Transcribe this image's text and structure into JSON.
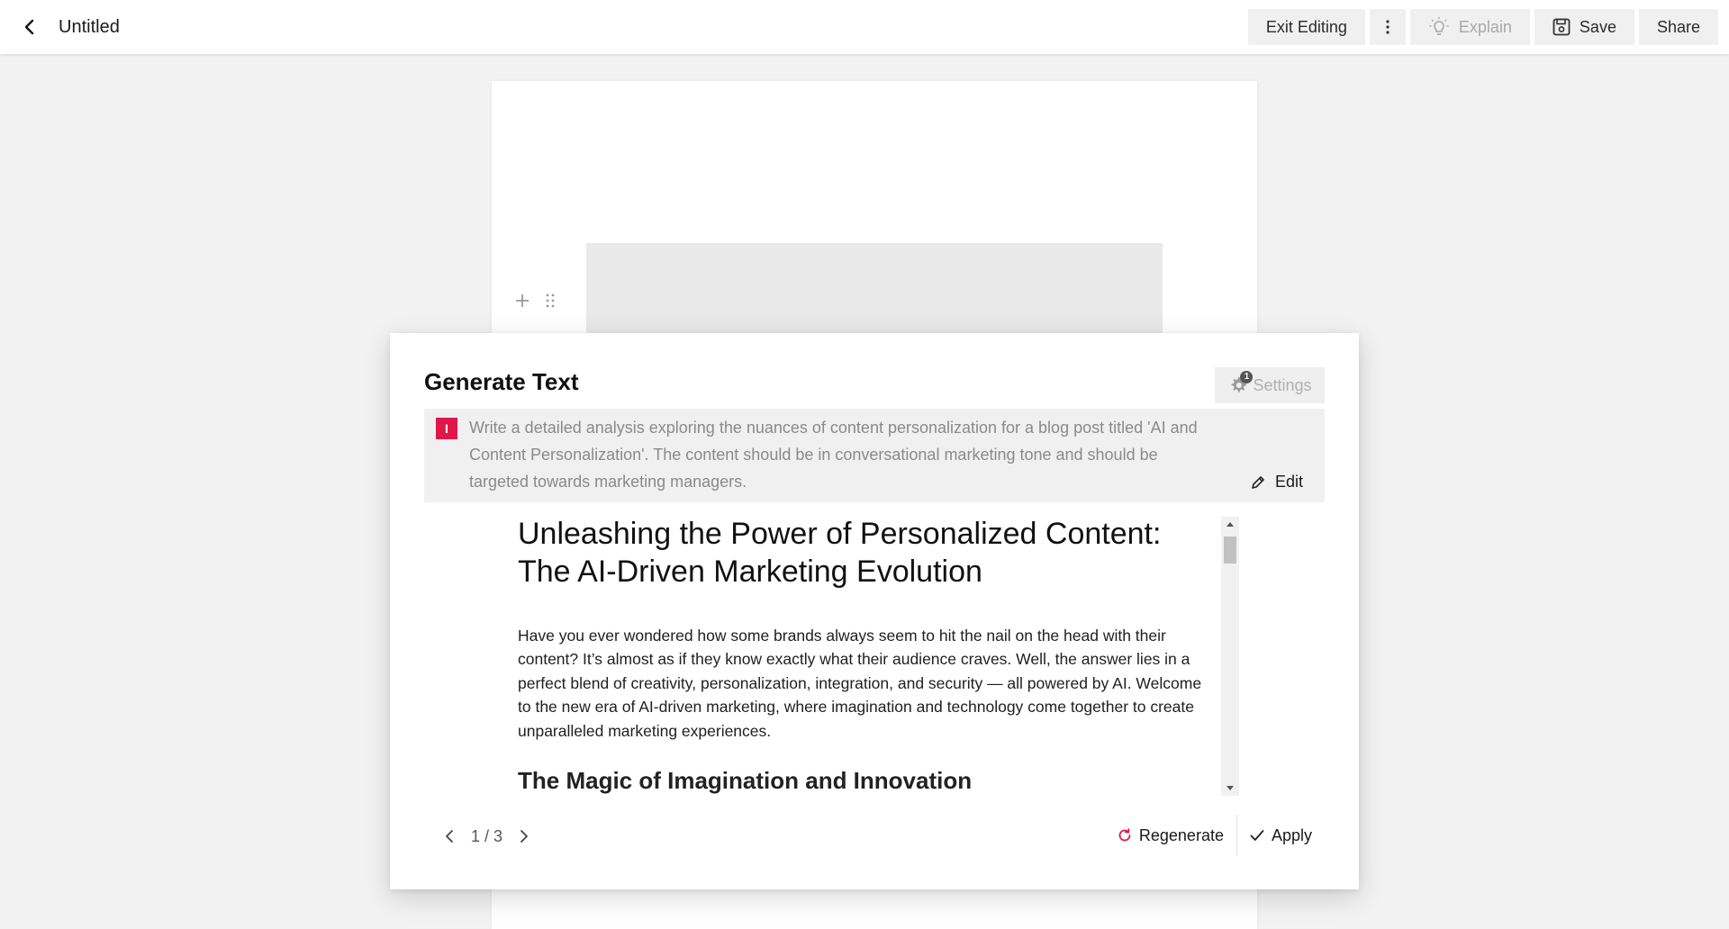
{
  "header": {
    "title": "Untitled",
    "exit_editing": "Exit Editing",
    "explain": "Explain",
    "save": "Save",
    "share": "Share"
  },
  "modal": {
    "title": "Generate Text",
    "settings": "Settings",
    "settings_badge": "1",
    "user_initial": "I",
    "prompt": "Write a detailed analysis exploring the nuances of content personalization for a blog post titled 'AI and Content Personalization'. The content should be in conversational marketing tone and should be targeted towards marketing managers.",
    "edit": "Edit",
    "result": {
      "heading": "Unleashing the Power of Personalized Content: The AI-Driven Marketing Evolution",
      "paragraph": "Have you ever wondered how some brands always seem to hit the nail on the head with their content? It’s almost as if they know exactly what their audience craves. Well, the answer lies in a perfect blend of creativity, personalization, integration, and security — all powered by AI. Welcome to the new era of AI-driven marketing, where imagination and technology come together to create unparalleled marketing experiences.",
      "subheading": "The Magic of Imagination and Innovation"
    },
    "pager": "1 / 3",
    "regenerate": "Regenerate",
    "apply": "Apply"
  },
  "colors": {
    "accent_red": "#e0174a",
    "background": "#f2f2f2",
    "muted_text": "#8a8a8a"
  },
  "icons": [
    "chevron-left-icon",
    "kebab-menu-icon",
    "lightbulb-icon",
    "floppy-disk-icon",
    "plus-icon",
    "drag-handle-icon",
    "gear-icon",
    "pencil-icon",
    "refresh-icon",
    "checkmark-icon",
    "chevron-right-icon"
  ]
}
